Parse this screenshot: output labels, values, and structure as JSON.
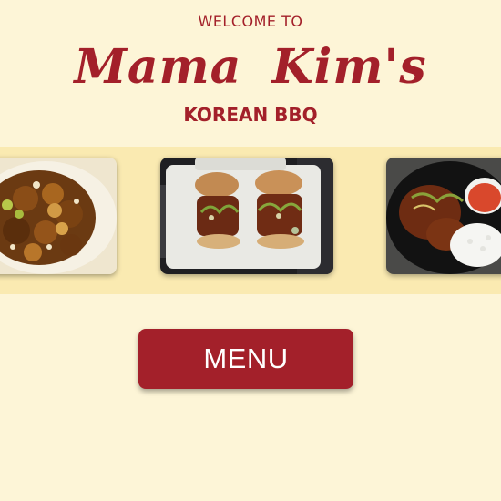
{
  "header": {
    "welcome": "WELCOME TO",
    "restaurant_name": "Mama Kim's",
    "subtitle": "KOREAN BBQ"
  },
  "gallery": {
    "images": [
      {
        "name": "braised-short-ribs-photo"
      },
      {
        "name": "sliders-takeout-photo"
      },
      {
        "name": "rice-bowl-photo"
      }
    ]
  },
  "menu_button": {
    "label": "MENU"
  },
  "colors": {
    "background": "#fdf5d7",
    "strip": "#faeab1",
    "accent": "#a3202a",
    "button_text": "#ffffff"
  }
}
